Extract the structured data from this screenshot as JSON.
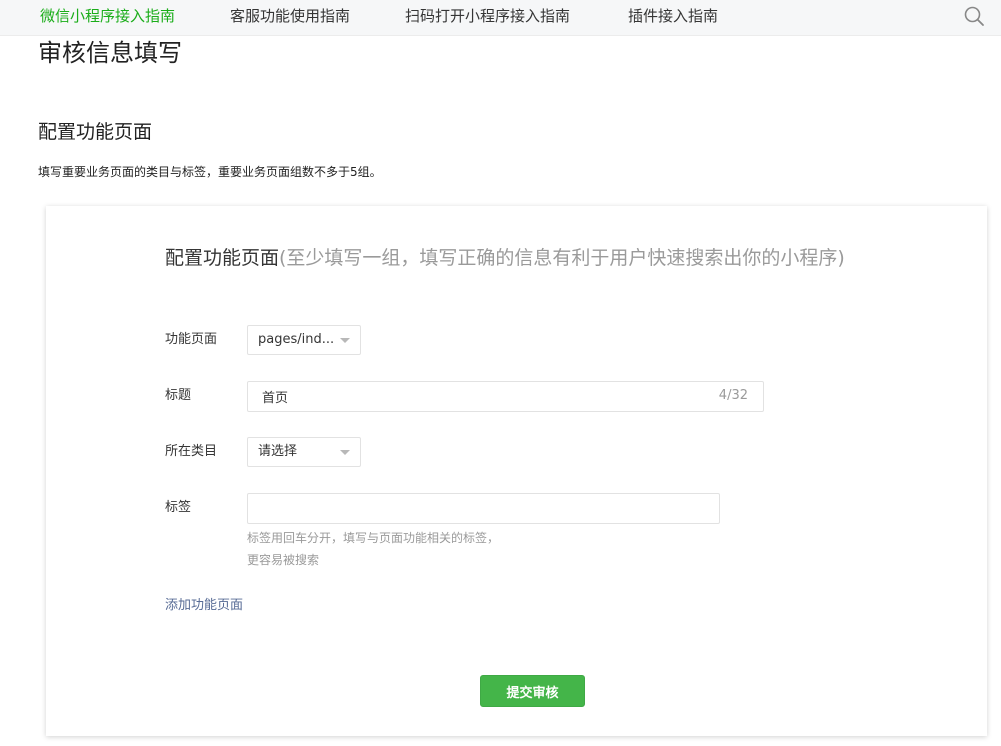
{
  "nav": {
    "tabs": [
      {
        "label": "微信小程序接入指南",
        "active": true
      },
      {
        "label": "客服功能使用指南",
        "active": false
      },
      {
        "label": "扫码打开小程序接入指南",
        "active": false
      },
      {
        "label": "插件接入指南",
        "active": false
      }
    ],
    "search_icon": "search-icon"
  },
  "page": {
    "title": "审核信息填写",
    "section_title": "配置功能页面",
    "section_desc": "填写重要业务页面的类目与标签，重要业务页面组数不多于5组。"
  },
  "card": {
    "heading": "配置功能页面",
    "heading_hint": "(至少填写一组，填写正确的信息有利于用户快速搜索出你的小程序)",
    "fields": {
      "page": {
        "label": "功能页面",
        "value": "pages/ind..."
      },
      "title": {
        "label": "标题",
        "value": "首页",
        "counter": "4/32"
      },
      "category": {
        "label": "所在类目",
        "value": "请选择"
      },
      "tags": {
        "label": "标签",
        "value": "",
        "tip_line1": "标签用回车分开，填写与页面功能相关的标签，",
        "tip_line2": "更容易被搜索"
      }
    },
    "add_link": "添加功能页面",
    "submit_label": "提交审核"
  },
  "colors": {
    "accent": "#1aad19",
    "button": "#44b549",
    "link": "#576b95",
    "muted": "#9a9a9a"
  }
}
